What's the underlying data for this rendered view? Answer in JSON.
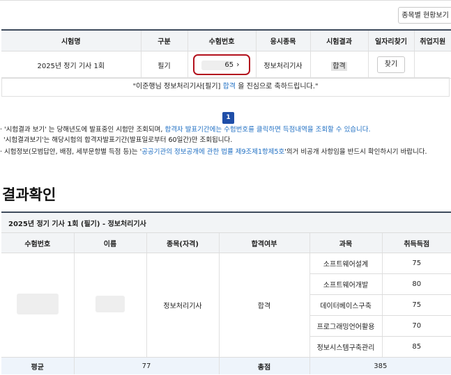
{
  "toolbar": {
    "view_by_subject_label": "종목별 현황보기"
  },
  "exam_table": {
    "headers": [
      "시험명",
      "구분",
      "수험번호",
      "응시종목",
      "시험결과",
      "일자리찾기",
      "취업지원"
    ],
    "row": {
      "exam_name": "2025년 정기 기사 1회",
      "type": "필기",
      "exam_number_visible": "65",
      "chevron": "›",
      "subject": "정보처리기사",
      "result": "합격",
      "find_job_label": "찾기",
      "employment_support": ""
    },
    "congrats": {
      "prefix": "\"이준행님 정보처리기사[필기]",
      "highlight": "합격",
      "suffix": "을 진심으로 축하드립니다.\""
    }
  },
  "pagination": {
    "current": "1"
  },
  "notices": {
    "n1_a": "· '시험결과 보기' 는 당해년도에 발표중인 시험만 조회되며,",
    "n1_b": "합격자 발표기간에는 수험번호를 클릭하면 득점내역을 조회할 수 있습니다.",
    "n2": "'시험결과보기'는 해당시험의 합격자발표기간(발표일로부터 60일간)만 조회됩니다.",
    "n3_a": "· 시험정보(모범답안, 배점, 세부문항별 득점 등)는 '",
    "n3_b": "공공기관의 정보공개에 관한 법률 제9조제1항제5호",
    "n3_c": "'의거 비공개 사항임을 반드시 확인하시기 바랍니다."
  },
  "result_section": {
    "title": "결과확인",
    "caption": "2025년 정기 기사 1회 (필기) - 정보처리기사",
    "headers": [
      "수험번호",
      "이름",
      "종목(자격)",
      "합격여부",
      "과목",
      "취득득점"
    ],
    "subject_name": "정보처리기사",
    "pass_status": "합격",
    "subjects": [
      {
        "name": "소프트웨어설계",
        "score": "75"
      },
      {
        "name": "소프트웨어개발",
        "score": "80"
      },
      {
        "name": "데이터베이스구축",
        "score": "75"
      },
      {
        "name": "프로그래밍언어활용",
        "score": "70"
      },
      {
        "name": "정보시스템구축관리",
        "score": "85"
      }
    ],
    "footer": {
      "avg_label": "평균",
      "avg_value": "77",
      "total_label": "총점",
      "total_value": "385"
    }
  }
}
